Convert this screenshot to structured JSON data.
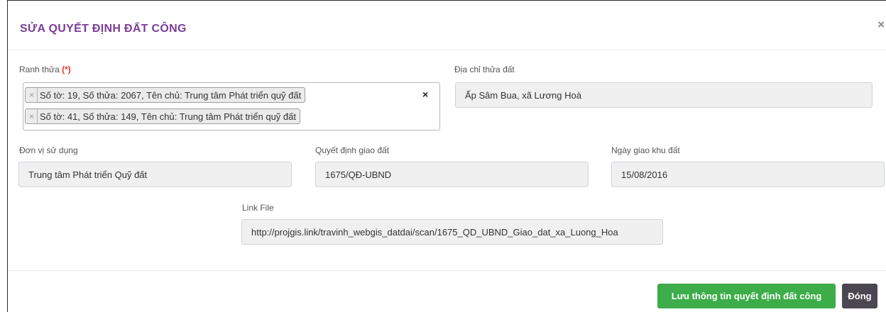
{
  "modal": {
    "title": "SỬA QUYẾT ĐỊNH ĐẤT CÔNG",
    "close_glyph": "×"
  },
  "form": {
    "ranh_thua": {
      "label": "Ranh thửa",
      "required_mark": "(*)",
      "tags": [
        "Số tờ: 19, Số thửa: 2067, Tên chủ: Trung tâm Phát triển quỹ đất",
        "Số tờ: 41, Số thửa: 149, Tên chủ: Trung tâm Phát triển quỹ đất"
      ],
      "tag_remove_glyph": "×",
      "clear_glyph": "×"
    },
    "dia_chi": {
      "label": "Địa chỉ thửa đất",
      "value": "Ấp Sâm Bua, xã Lương Hoà"
    },
    "don_vi": {
      "label": "Đơn vị sử dụng",
      "value": "Trung tâm Phát triển Quỹ đất"
    },
    "quyet_dinh": {
      "label": "Quyết định giao đất",
      "value": "1675/QĐ-UBND"
    },
    "ngay_giao": {
      "label": "Ngày giao khu đất",
      "value": "15/08/2016"
    },
    "link_file": {
      "label": "Link File",
      "value": "http://projgis.link/travinh_webgis_datdai/scan/1675_QD_UBND_Giao_dat_xa_Luong_Hoa"
    }
  },
  "footer": {
    "save_label": "Lưu thông tin quyết định đất công",
    "close_label": "Đóng"
  },
  "colors": {
    "title": "#7a3e96",
    "save_button": "#3cad48",
    "close_button": "#4b4750",
    "required": "#e8332d"
  }
}
